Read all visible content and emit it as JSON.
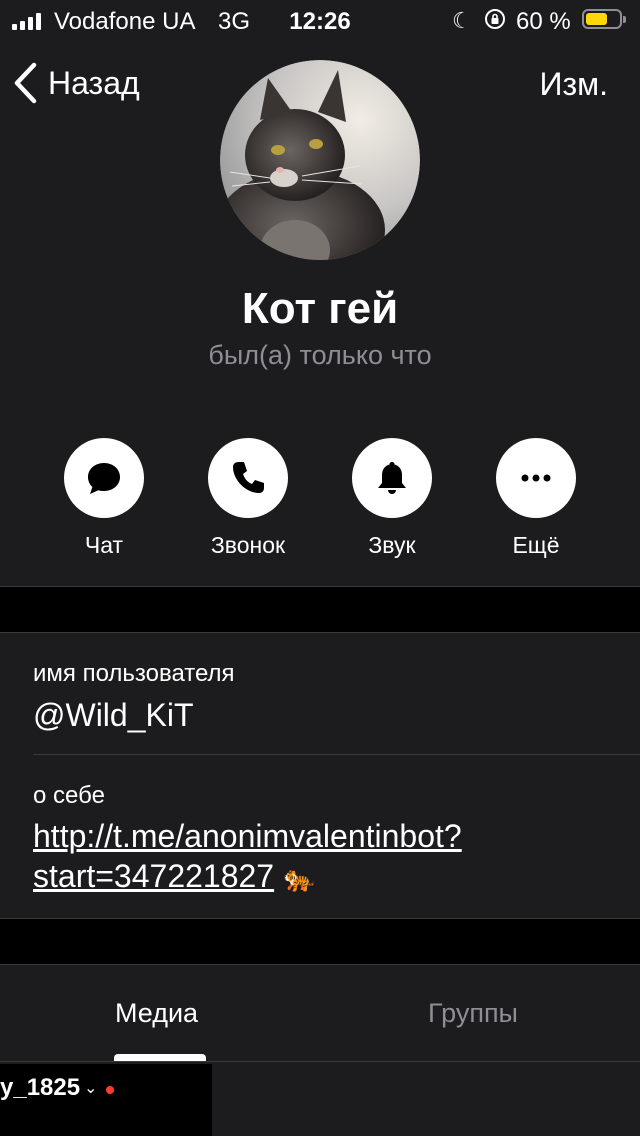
{
  "status_bar": {
    "carrier": "Vodafone UA",
    "network": "3G",
    "time": "12:26",
    "battery_percent": "60 %"
  },
  "nav": {
    "back_label": "Назад",
    "edit_label": "Изм."
  },
  "profile": {
    "name": "Кот гей",
    "last_seen": "был(а) только что"
  },
  "actions": [
    {
      "label": "Чат",
      "icon": "chat-bubble-icon"
    },
    {
      "label": "Звонок",
      "icon": "phone-icon"
    },
    {
      "label": "Звук",
      "icon": "bell-icon"
    },
    {
      "label": "Ещё",
      "icon": "ellipsis-icon"
    }
  ],
  "info": {
    "username_label": "имя пользователя",
    "username_value": "@Wild_KiT",
    "bio_label": "о себе",
    "bio_line1": "http://t.me/anonimvalentinbot?",
    "bio_line2": "start=347221827",
    "bio_emoji": "🐅"
  },
  "tabs": [
    {
      "label": "Медиа",
      "active": true
    },
    {
      "label": "Группы",
      "active": false
    }
  ],
  "overlay": {
    "text": "y_1825"
  },
  "colors": {
    "background": "#1c1c1e",
    "secondary_text": "#8e8e93",
    "battery": "#ffd60a",
    "record_dot": "#ff3b30"
  }
}
